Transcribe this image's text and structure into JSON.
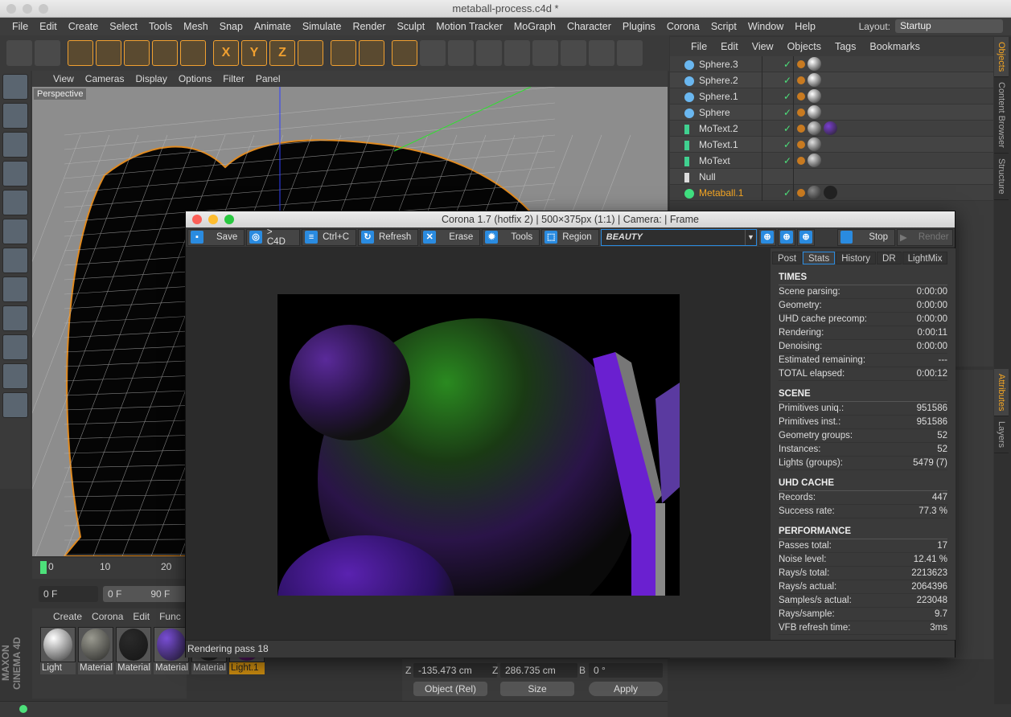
{
  "window": {
    "title": "metaball-process.c4d *"
  },
  "menu": [
    "File",
    "Edit",
    "Create",
    "Select",
    "Tools",
    "Mesh",
    "Snap",
    "Animate",
    "Simulate",
    "Render",
    "Sculpt",
    "Motion Tracker",
    "MoGraph",
    "Character",
    "Plugins",
    "Corona",
    "Script",
    "Window",
    "Help"
  ],
  "layout": {
    "label": "Layout:",
    "value": "Startup"
  },
  "toolbar": [
    "undo",
    "redo",
    "select",
    "move",
    "scale",
    "rotate",
    "transform",
    "X",
    "Y",
    "Z",
    "coords",
    "render-view",
    "render",
    "render-settings",
    "cube",
    "pen",
    "subdiv",
    "cloner",
    "deformer",
    "floor",
    "camera",
    "light"
  ],
  "viewport": {
    "menu": [
      "View",
      "Cameras",
      "Display",
      "Options",
      "Filter",
      "Panel"
    ],
    "label": "Perspective"
  },
  "object_manager": {
    "menu": [
      "File",
      "Edit",
      "View",
      "Objects",
      "Tags",
      "Bookmarks"
    ],
    "objects": [
      {
        "name": "Sphere.3",
        "type": "sphere",
        "tags": [
          "#ffffff"
        ]
      },
      {
        "name": "Sphere.2",
        "type": "sphere",
        "tags": [
          "#ffffff"
        ]
      },
      {
        "name": "Sphere.1",
        "type": "sphere",
        "tags": [
          "#ffffff"
        ]
      },
      {
        "name": "Sphere",
        "type": "sphere",
        "tags": [
          "#ffffff"
        ]
      },
      {
        "name": "MoText.2",
        "type": "text",
        "tags": [
          "#e0e0e0",
          "#7a3fd0"
        ]
      },
      {
        "name": "MoText.1",
        "type": "text",
        "tags": [
          "#e0e0e0"
        ]
      },
      {
        "name": "MoText",
        "type": "text",
        "tags": [
          "#e0e0e0"
        ]
      },
      {
        "name": "Null",
        "type": "null",
        "tags": []
      },
      {
        "name": "Metaball.1",
        "type": "metaball",
        "selected": true,
        "tags": [
          "#888888",
          "#222222"
        ]
      }
    ]
  },
  "right_tabs": [
    "Objects",
    "Content Browser",
    "Structure"
  ],
  "right_tabs_lower": [
    "Attributes",
    "Layers"
  ],
  "timeline": {
    "ticks": [
      "0",
      "10",
      "20"
    ],
    "current": "0 F",
    "start": "0 F",
    "end": "90 F"
  },
  "materials": {
    "menu": [
      "Create",
      "Corona",
      "Edit",
      "Func"
    ],
    "items": [
      {
        "label": "Light",
        "color": "#ffffff"
      },
      {
        "label": "Material",
        "color": "#9a9a90"
      },
      {
        "label": "Material",
        "color": "#2a2a2a"
      },
      {
        "label": "Material",
        "color": "#7a4fd8"
      },
      {
        "label": "Material",
        "color": "#444"
      },
      {
        "label": "Light.1",
        "color": "#b020d0"
      }
    ]
  },
  "coords": {
    "z_pos": "-135.473 cm",
    "z_size": "286.735 cm",
    "b_rot": "0 °",
    "mode": "Object (Rel)",
    "size_mode": "Size",
    "apply": "Apply",
    "z": "Z",
    "b": "B"
  },
  "brand": "MAXON CINEMA 4D",
  "vfb": {
    "title": "Corona 1.7 (hotfix 2) | 500×375px (1:1) | Camera:  | Frame",
    "buttons": [
      {
        "label": "Save",
        "icon": "save-icon"
      },
      {
        "label": "> C4D",
        "icon": "c4d-icon"
      },
      {
        "label": "Ctrl+C",
        "icon": "copy-icon"
      },
      {
        "label": "Refresh",
        "icon": "refresh-icon"
      },
      {
        "label": "Erase",
        "icon": "erase-icon"
      },
      {
        "label": "Tools",
        "icon": "gear-icon"
      },
      {
        "label": "Region",
        "icon": "region-icon"
      }
    ],
    "pass": "BEAUTY",
    "stop": "Stop",
    "render": "Render",
    "tabs": [
      "Post",
      "Stats",
      "History",
      "DR",
      "LightMix"
    ],
    "active_tab": "Stats",
    "status": "Rendering pass 18",
    "stats": [
      {
        "title": "TIMES",
        "rows": [
          [
            "Scene parsing:",
            "0:00:00"
          ],
          [
            "Geometry:",
            "0:00:00"
          ],
          [
            "UHD cache precomp:",
            "0:00:00"
          ],
          [
            "Rendering:",
            "0:00:11"
          ],
          [
            "Denoising:",
            "0:00:00"
          ],
          [
            "Estimated remaining:",
            "---"
          ],
          [
            "TOTAL elapsed:",
            "0:00:12"
          ]
        ]
      },
      {
        "title": "SCENE",
        "rows": [
          [
            "Primitives uniq.:",
            "951586"
          ],
          [
            "Primitives inst.:",
            "951586"
          ],
          [
            "Geometry groups:",
            "52"
          ],
          [
            "Instances:",
            "52"
          ],
          [
            "Lights (groups):",
            "5479 (7)"
          ]
        ]
      },
      {
        "title": "UHD CACHE",
        "rows": [
          [
            "Records:",
            "447"
          ],
          [
            "Success rate:",
            "77.3 %"
          ]
        ]
      },
      {
        "title": "PERFORMANCE",
        "rows": [
          [
            "Passes total:",
            "17"
          ],
          [
            "Noise level:",
            "12.41 %"
          ],
          [
            "Rays/s total:",
            "2213623"
          ],
          [
            "Rays/s actual:",
            "2064396"
          ],
          [
            "Samples/s actual:",
            "223048"
          ],
          [
            "Rays/sample:",
            "9.7"
          ],
          [
            "VFB refresh time:",
            "3ms"
          ]
        ]
      }
    ]
  },
  "colors": {
    "accent": "#2a8be0",
    "selection": "#f5a623"
  }
}
